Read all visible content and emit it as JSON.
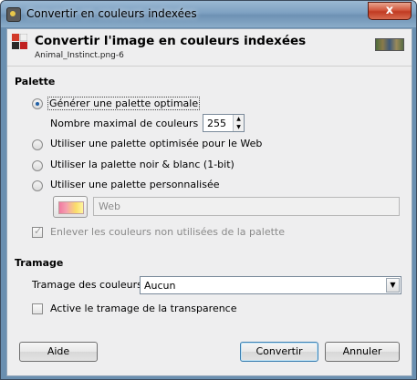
{
  "window": {
    "title": "Convertir en couleurs indexées",
    "close_glyph": "x"
  },
  "header": {
    "title": "Convertir l'image en couleurs indexées",
    "subtitle": "Animal_Instinct.png-6"
  },
  "palette": {
    "section_title": "Palette",
    "options": {
      "optimal": "Générer une palette optimale",
      "max_colors_label": "Nombre maximal de couleurs :",
      "max_colors_value": "255",
      "web": "Utiliser une palette optimisée pour le Web",
      "bw": "Utiliser la palette noir & blanc (1-bit)",
      "custom": "Utiliser une palette personnalisée",
      "custom_entry_value": "Web",
      "remove_unused": "Enlever les couleurs non utilisées de la palette"
    }
  },
  "dithering": {
    "section_title": "Tramage",
    "color_dither_label": "Tramage des couleurs",
    "color_dither_value": "Aucun",
    "transparency_dither": "Active le tramage de la transparence"
  },
  "buttons": {
    "help": "Aide",
    "convert": "Convertir",
    "cancel": "Annuler"
  },
  "colors": {
    "titlebar": "#7ea1c2",
    "close": "#c03a22",
    "client_bg": "#eeeeef",
    "radio_dot": "#1f5fa6"
  }
}
